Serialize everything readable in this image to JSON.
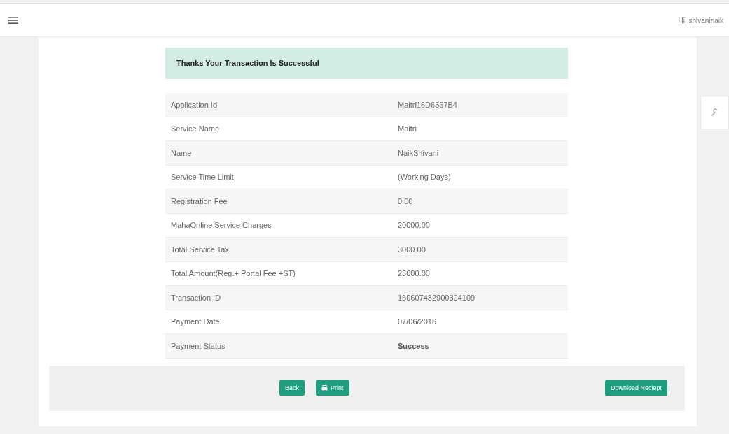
{
  "header": {
    "greeting": "Hi, shivaninaik"
  },
  "alert": {
    "message": "Thanks Your Transaction Is Successful"
  },
  "details": [
    {
      "label": "Application Id",
      "value": "Maitri16D6567B4",
      "emphasis": false
    },
    {
      "label": "Service Name",
      "value": "Maitri",
      "emphasis": false
    },
    {
      "label": "Name",
      "value": "NaikShivani",
      "emphasis": false
    },
    {
      "label": "Service Time Limit",
      "value": "(Working Days)",
      "emphasis": false
    },
    {
      "label": "Registration Fee",
      "value": "0.00",
      "emphasis": false
    },
    {
      "label": "MahaOnline Service Charges",
      "value": "20000.00",
      "emphasis": false
    },
    {
      "label": "Total Service Tax",
      "value": "3000.00",
      "emphasis": false
    },
    {
      "label": "Total Amount(Reg.+ Portal Fee +ST)",
      "value": "23000.00",
      "emphasis": false
    },
    {
      "label": "Transaction ID",
      "value": "160607432900304109",
      "emphasis": false
    },
    {
      "label": "Payment Date",
      "value": "07/06/2016",
      "emphasis": false
    },
    {
      "label": "Payment Status",
      "value": "Success",
      "emphasis": true
    }
  ],
  "buttons": [
    {
      "label": "Back",
      "kind": "plain"
    },
    {
      "label": "Print",
      "kind": "print"
    },
    {
      "label": "Download Reciept",
      "kind": "download"
    }
  ]
}
